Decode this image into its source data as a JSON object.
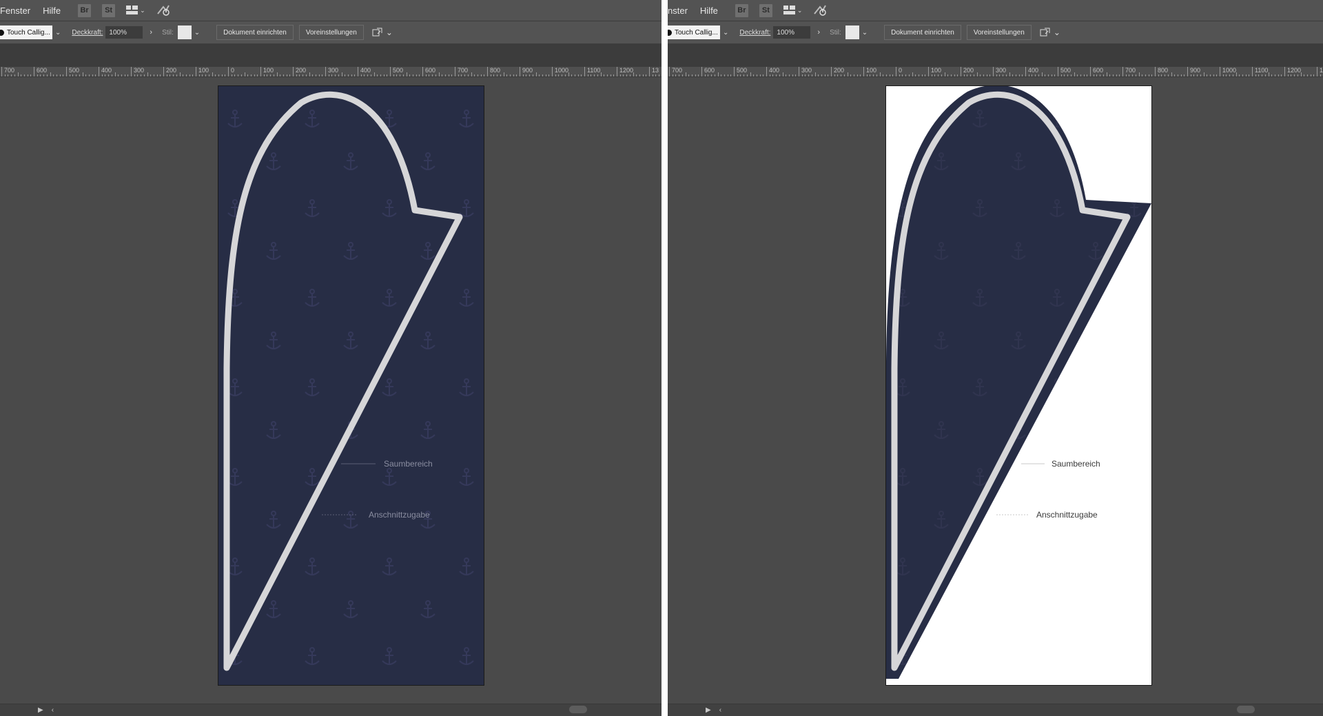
{
  "menu": {
    "left": [
      "Fenster",
      "Hilfe"
    ],
    "right": [
      "nster",
      "Hilfe"
    ]
  },
  "app_icons": [
    "Br",
    "St"
  ],
  "control_bar": {
    "brush": "Touch Callig...",
    "opacity_label": "Deckkraft:",
    "opacity_value": "100%",
    "style_label": "Stil:",
    "setup_button": "Dokument einrichten",
    "prefs_button": "Voreinstellungen"
  },
  "ruler": {
    "labels": [
      "700",
      "600",
      "500",
      "400",
      "300",
      "200",
      "100",
      "0",
      "100",
      "200",
      "300",
      "400",
      "500",
      "600",
      "700",
      "800",
      "900",
      "1000",
      "1100",
      "1200",
      "13"
    ]
  },
  "annotations": {
    "hem": "Saumbereich",
    "bleed": "Anschnittzugabe"
  },
  "colors": {
    "navy": "#272d45",
    "outline": "#d6d6d8",
    "canvas_bg": "#4a4a4a"
  },
  "icons": {
    "workspace": "workspace-switcher-icon",
    "sync": "sync-icon",
    "arrange": "arrange-documents-icon"
  }
}
